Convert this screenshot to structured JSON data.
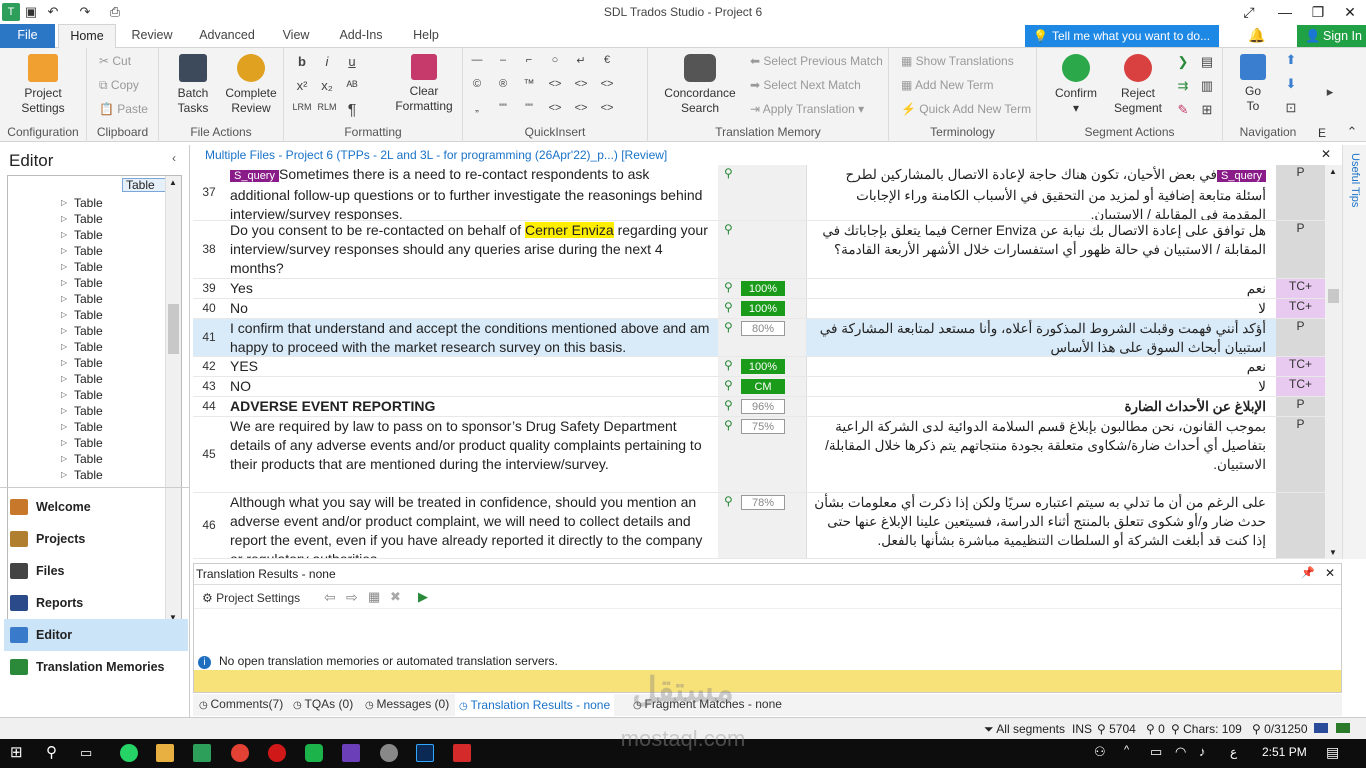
{
  "titlebar": {
    "title": "SDL Trados Studio - Project 6"
  },
  "tabs": {
    "file": "File",
    "home": "Home",
    "review": "Review",
    "advanced": "Advanced",
    "view": "View",
    "addins": "Add-Ins",
    "help": "Help",
    "tellme": "Tell me what you want to do...",
    "signin": "Sign In"
  },
  "ribbon": {
    "config": {
      "btn1": "Project",
      "btn2": "Settings",
      "label": "Configuration"
    },
    "clipboard": {
      "cut": "Cut",
      "copy": "Copy",
      "paste": "Paste",
      "label": "Clipboard"
    },
    "fileactions": {
      "batch1": "Batch",
      "batch2": "Tasks",
      "complete1": "Complete",
      "complete2": "Review",
      "label": "File Actions"
    },
    "formatting": {
      "clear1": "Clear",
      "clear2": "Formatting",
      "label": "Formatting",
      "b": "b",
      "i": "i",
      "u": "u",
      "x2": "x²",
      "x2sub": "x₂",
      "ltr": "LRM",
      "rlm": "RLM",
      "pil": "¶"
    },
    "quickinsert": {
      "label": "QuickInsert",
      "row1": [
        "—",
        "–",
        "⌐",
        "○",
        "↵",
        "€"
      ],
      "row2": [
        "©",
        "®",
        "™",
        "<>",
        "<>",
        "<>"
      ],
      "row3": [
        "„",
        "\"\"",
        "\"\"",
        "<>",
        "<>",
        "<>"
      ]
    },
    "tm": {
      "concordance1": "Concordance",
      "concordance2": "Search",
      "prev": "Select Previous Match",
      "next": "Select Next Match",
      "apply": "Apply Translation",
      "label": "Translation Memory"
    },
    "terminology": {
      "show": "Show Translations",
      "add": "Add New Term",
      "quick": "Quick Add New Term",
      "label": "Terminology"
    },
    "segment": {
      "confirm": "Confirm",
      "reject1": "Reject",
      "reject2": "Segment",
      "label": "Segment Actions"
    },
    "navigation": {
      "goto1": "Go",
      "goto2": "To",
      "label": "Navigation",
      "e": "E"
    }
  },
  "leftpanel": {
    "title": "Editor",
    "tree_header": "Table",
    "tree_items": [
      "Table",
      "Table",
      "Table",
      "Table",
      "Table",
      "Table",
      "Table",
      "Table",
      "Table",
      "Table",
      "Table",
      "Table",
      "Table",
      "Table",
      "Table",
      "Table",
      "Table",
      "Table"
    ],
    "nav": [
      "Welcome",
      "Projects",
      "Files",
      "Reports",
      "Editor",
      "Translation Memories"
    ]
  },
  "editor": {
    "header": "Multiple Files - Project 6 (TPPs - 2L and 3L - for programming (26Apr'22)_p...) [Review]",
    "side_tab": "Useful Tips",
    "rows": [
      {
        "num": "37",
        "src_tag": "S_query",
        "src": "Sometimes there is a need to re-contact respondents to ask additional follow-up questions or to further investigate the reasonings behind interview/survey responses.",
        "pct": "",
        "tgt_tag": "S_query",
        "tgt": "في بعض الأحيان، تكون هناك حاجة لإعادة الاتصال بالمشاركين لطرح أسئلة متابعة إضافية أو لمزيد من التحقيق في الأسباب الكامنة وراء الإجابات المقدمة في المقابلة / الاستبيان.",
        "status": "P"
      },
      {
        "num": "38",
        "src_a": "Do you consent to be re-contacted on behalf of ",
        "src_hl": "Cerner Enviza",
        "src_b": " regarding your interview/survey responses should any queries arise during the next 4 months?",
        "pct": "",
        "tgt": "هل توافق على إعادة الاتصال بك نيابة عن Cerner Enviza فيما يتعلق بإجاباتك في المقابلة / الاستبيان في حالة ظهور أي استفسارات خلال الأشهر الأربعة القادمة؟",
        "status": "P"
      },
      {
        "num": "39",
        "src": "Yes",
        "pct": "100%",
        "tgt": "نعم",
        "status": "TC+"
      },
      {
        "num": "40",
        "src": "No",
        "pct": "100%",
        "tgt": "لا",
        "status": "TC+"
      },
      {
        "num": "41",
        "src": "I confirm that understand and accept the conditions mentioned above and am happy to proceed with the market research survey on this basis.",
        "pct": "80%",
        "tgt": "أؤكد أنني فهمت وقبلت الشروط المذكورة أعلاه، وأنا مستعد لمتابعة المشاركة في استبيان أبحاث السوق على هذا الأساس",
        "status": "P"
      },
      {
        "num": "42",
        "src": "YES",
        "pct": "100%",
        "tgt": "نعم",
        "status": "TC+"
      },
      {
        "num": "43",
        "src": "NO",
        "pct": "CM",
        "tgt": "لا",
        "status": "TC+"
      },
      {
        "num": "44",
        "src": "ADVERSE EVENT REPORTING",
        "pct": "96%",
        "tgt": "الإبلاغ عن الأحداث الضارة",
        "status": "P"
      },
      {
        "num": "45",
        "src": "We are required by law to pass on to sponsor’s Drug Safety Department details of any adverse events and/or product quality complaints pertaining to their products that are mentioned during the interview/survey.",
        "pct": "75%",
        "tgt": "بموجب القانون، نحن مطالبون بإبلاغ قسم السلامة الدوائية لدى الشركة الراعية بتفاصيل أي أحداث ضارة/شكاوى متعلقة بجودة منتجاتهم يتم ذكرها خلال المقابلة/ الاستبيان.",
        "status": "P"
      },
      {
        "num": "46",
        "src": "Although what you say will be treated in confidence, should you mention an adverse event and/or product complaint, we will need to collect details and report the event, even if you have already reported it directly to the company or regulatory authorities.",
        "pct": "78%",
        "tgt": "على الرغم من أن ما تدلي به سيتم اعتباره سريًا ولكن إذا ذكرت أي معلومات بشأن حدث ضار و/أو شكوى تتعلق بالمنتج أثناء الدراسة، فسيتعين علينا الإبلاغ عنها حتى إذا كنت قد أبلغت الشركة أو السلطات التنظيمية مباشرة بشأنها بالفعل.",
        "status": ""
      }
    ]
  },
  "trpanel": {
    "title": "Translation Results - none",
    "settings": "Project Settings",
    "info": "No open translation memories or automated translation servers."
  },
  "bottomtabs": [
    "Comments(7)",
    "TQAs (0)",
    "Messages (0)",
    "Translation Results - none",
    "Fragment Matches - none"
  ],
  "statusbar": {
    "segments": "All segments",
    "ins": "INS",
    "count1": "5704",
    "count2": "0",
    "chars": "Chars: 109",
    "ratio": "0/31250"
  },
  "taskbar": {
    "time": "2:51 PM",
    "lang": "ع"
  },
  "watermark": {
    "line1": "مستقل",
    "line2": "mostaql.com"
  },
  "colors": {
    "accent": "#2b77c5",
    "green": "#1a9b1a",
    "tc": "#e8c9ef",
    "highlight": "#ffee00",
    "tag": "#8a1c8a"
  }
}
